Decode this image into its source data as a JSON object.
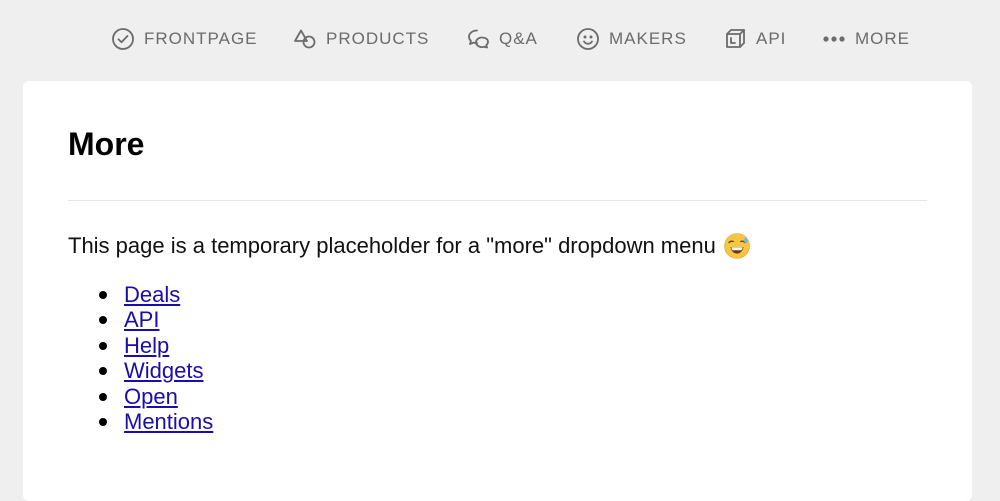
{
  "nav": {
    "items": [
      {
        "label": "FRONTPAGE",
        "icon": "check-circle-icon"
      },
      {
        "label": "PRODUCTS",
        "icon": "shapes-icon"
      },
      {
        "label": "Q&A",
        "icon": "chat-bubbles-icon"
      },
      {
        "label": "MAKERS",
        "icon": "smiley-icon"
      },
      {
        "label": "API",
        "icon": "cube-icon"
      },
      {
        "label": "MORE",
        "icon": "more-dots-icon"
      }
    ]
  },
  "main": {
    "title": "More",
    "intro": "This page is a temporary placeholder for a \"more\" dropdown menu",
    "emoji": "grinning-sweat-emoji",
    "links": [
      "Deals",
      "API",
      "Help",
      "Widgets",
      "Open",
      "Mentions"
    ]
  },
  "colors": {
    "background": "#efefef",
    "card": "#ffffff",
    "nav_text": "#6b6b6b",
    "link": "#1a0dab"
  }
}
